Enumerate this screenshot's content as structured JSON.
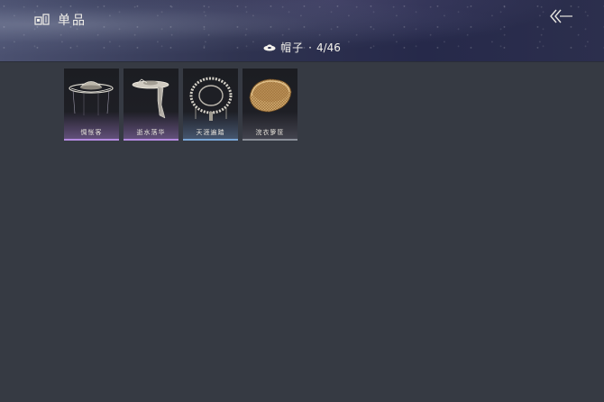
{
  "header": {
    "title": "单品",
    "title_icon": "wardrobe-icon",
    "back_icon": "double-chevron-left-icon"
  },
  "category": {
    "icon": "hat-icon",
    "label": "帽子",
    "separator": "·",
    "count": "4/46"
  },
  "items": [
    {
      "name": "惆怅客",
      "icon": "wide-brim-veil-hat-icon",
      "rarity_color": "#b48ae0"
    },
    {
      "name": "逝水落华",
      "icon": "flat-hat-with-drape-icon",
      "rarity_color": "#b48ae0"
    },
    {
      "name": "天涯遍踏",
      "icon": "woven-frame-hat-icon",
      "rarity_color": "#7aa6d6"
    },
    {
      "name": "浣衣箩筐",
      "icon": "woven-basket-icon",
      "rarity_color": "#8a8f99"
    }
  ],
  "colors": {
    "background": "#363a43",
    "header_dark": "#26294a",
    "card_bg": "#1e1f25",
    "purple_rarity": "#b48ae0",
    "blue_rarity": "#7aa6d6",
    "grey_rarity": "#8a8f99"
  }
}
